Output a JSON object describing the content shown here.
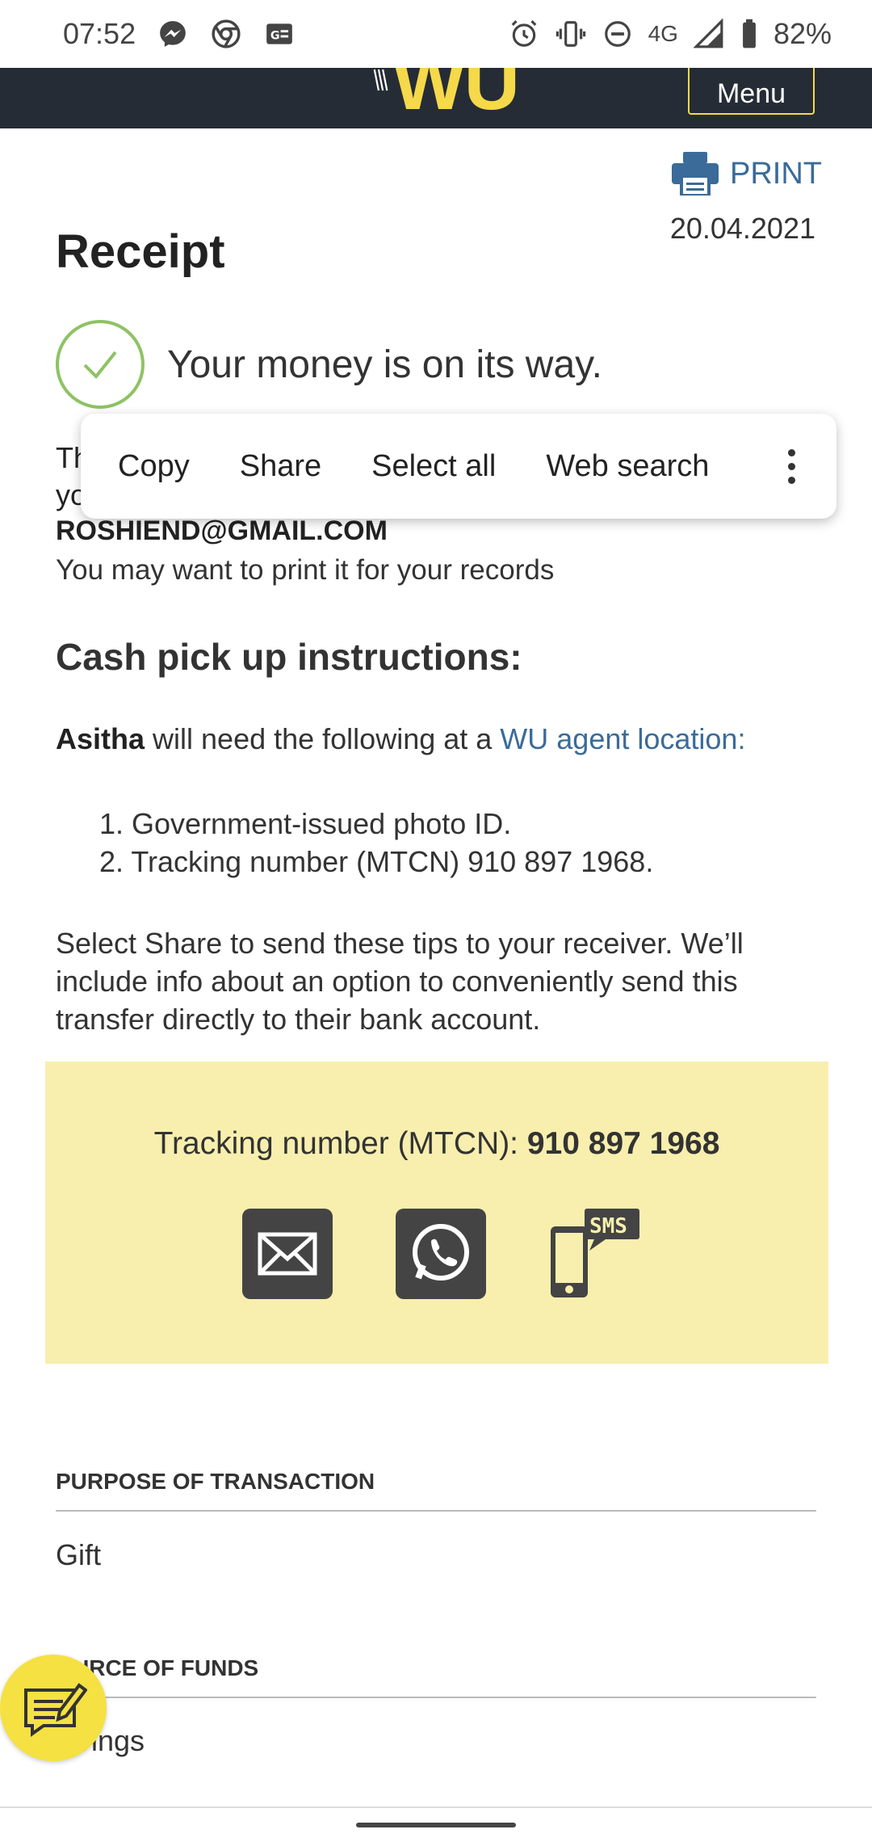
{
  "status_bar": {
    "time": "07:52",
    "network": "4G",
    "battery": "82%",
    "left_icons": [
      "messenger-icon",
      "chrome-icon",
      "news-icon"
    ],
    "right_icons": [
      "alarm-icon",
      "vibrate-icon",
      "dnd-icon",
      "signal-icon",
      "battery-icon"
    ]
  },
  "header": {
    "logo": "WU",
    "menu_label": "Menu",
    "accent_color": "#f5d94a",
    "bg_color": "#262c35"
  },
  "receipt": {
    "print_label": "PRINT",
    "date": "20.04.2021",
    "title": "Receipt",
    "success_message": "Your money is on its way.",
    "partial_line1": "Th",
    "partial_line2": "yo",
    "email": "ROSHIEND@GMAIL.COM",
    "print_note": "You may want to print it for your records"
  },
  "context_menu": {
    "items": [
      "Copy",
      "Share",
      "Select all",
      "Web search"
    ]
  },
  "instructions": {
    "title": "Cash pick up instructions:",
    "receiver": "Asitha",
    "lead_text": " will need the following at a ",
    "agent_link": "WU agent location:",
    "steps": [
      "1. Government-issued photo ID.",
      "2. Tracking number (MTCN) 910 897 1968."
    ],
    "tips": "Select Share to send these tips to your receiver. We’ll include info about an option to conveniently send this transfer directly to their bank account."
  },
  "tracking": {
    "label": "Tracking number (MTCN): ",
    "number": "910 897 1968",
    "bg_color": "#f8efae",
    "share_options": [
      "email-icon",
      "whatsapp-icon",
      "sms-icon"
    ]
  },
  "fields": {
    "purpose_label": "PURPOSE OF TRANSACTION",
    "purpose_value": "Gift",
    "source_label": "URCE OF FUNDS",
    "source_value": "vings"
  }
}
